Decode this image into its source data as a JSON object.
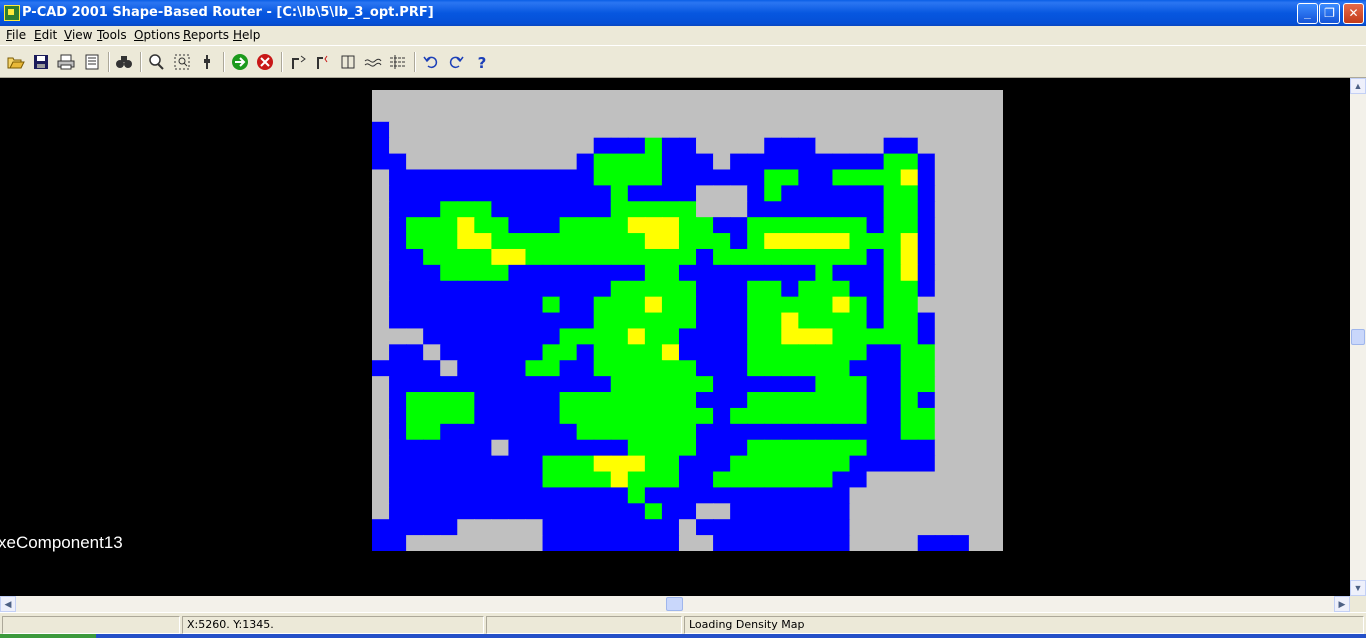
{
  "window": {
    "title": "P-CAD 2001 Shape-Based Router - [C:\\lb\\5\\lb_3_opt.PRF]",
    "buttons": {
      "minimize": "_",
      "restore": "❐",
      "close": "✕"
    }
  },
  "menu": [
    {
      "label": "File",
      "hotkey": "F",
      "rest": "ile"
    },
    {
      "label": "Edit",
      "hotkey": "E",
      "rest": "dit"
    },
    {
      "label": "View",
      "hotkey": "V",
      "rest": "iew"
    },
    {
      "label": "Tools",
      "hotkey": "T",
      "rest": "ools"
    },
    {
      "label": "Options",
      "hotkey": "O",
      "rest": "ptions"
    },
    {
      "label": "Reports",
      "hotkey": "R",
      "rest": "eports"
    },
    {
      "label": "Help",
      "hotkey": "H",
      "rest": "elp"
    }
  ],
  "toolbar": [
    {
      "name": "open-icon"
    },
    {
      "name": "save-icon"
    },
    {
      "name": "print-icon"
    },
    {
      "name": "print-setup-icon"
    },
    {
      "name": "find-icon"
    },
    {
      "name": "zoom-icon"
    },
    {
      "name": "zoom-window-icon"
    },
    {
      "name": "pin-icon"
    },
    {
      "name": "start-route-icon"
    },
    {
      "name": "stop-route-icon"
    },
    {
      "name": "route-1-icon"
    },
    {
      "name": "route-2-icon"
    },
    {
      "name": "route-3-icon"
    },
    {
      "name": "route-4-icon"
    },
    {
      "name": "route-5-icon"
    },
    {
      "name": "undo-icon"
    },
    {
      "name": "redo-icon"
    },
    {
      "name": "help-icon"
    }
  ],
  "canvas": {
    "label": "xeComponent13",
    "density_colors": {
      "G": "#c0c0c0",
      "B": "#0000ff",
      "N": "#00ff00",
      "Y": "#ffff00",
      "K": "#000000"
    },
    "density_map": [
      "GGGGGGGGGGGGGGGGGGGGGGGGGGGGGGGGGGGGG",
      "GGGGGGGGGGGGGGGGGGGGGGGGGGGGGGGGGGGGG",
      "BGGGGGGGGGGGGGGGGGGGGGGGGGGGGGGGGGGGG",
      "BGGGGGGGGGGGGBBBNBBGGGGBBBGGGGBBGGGGG",
      "BBGGGGGGGGGGBNNNNBBBGBBBBBBBBBNNBGGGG",
      "GBBBBBBBBBBBBNNNNBBBBBBNNBBNNNNYBGGGG",
      "GBBBBBBBBBBBBBNBBBBGGGBNBBBBBBNNBGGGG",
      "GBBBNNNBBBBBBBNNNNNGGGBBBBBBBBNNBGGGG",
      "GBNNNYNNBBBNNNNYYYNNBBNNNNNNNBNNBGGGG",
      "GBNNNYYNNNNNNNNNYYNNNBNYYYYYNNNYBGGGG",
      "GBBNNNNYYNNNNNNNNNNBNNNNNNNNNBNYBGGGG",
      "GBBBNNNNBBBBBBBBNNBBBBBBBBNBBBNYBGGGG",
      "GBBBBBBBBBBBBBNNNNNBBBNNBNNNBBNNBGGGG",
      "GBBBBBBBBBNBBNNNYNNBBBNNNNNYNBNNGGGGG",
      "GBBBBBBBBBBBBNNNNNNBBBNNYNNNNBNNBGGGG",
      "GGGBBBBBBBBNNNNYNNBBBBNNYYYNNNNNBGGGG",
      "GBBGBBBBBBNNBNNNNYBBBBNNNNNNNBBNNGGGG",
      "BBBBGBBBBNNBBNNNNNNBBBNNNNNNBBBNNGGGG",
      "GBBBBBBBBBBBBBNNNNNNBBBBBBNNNBBNNGGGG",
      "GBNNNNBBBBBNNNNNNNNBBBNNNNNNNBBNBGGGG",
      "GBNNNNBBBBBNNNNNNNNNBNNNNNNNNBBNNGGGG",
      "GBNNBBBBBBBBNNNNNNNBBBBBBBBBBBBNNGGGG",
      "GBBBBBBGBBBBBBBNNNNBBBNNNNNNNBBBBGGGG",
      "GBBBBBBBBBNNNYYYNNBBBNNNNNNNBBBBBGGGG",
      "GBBBBBBBBBNNNNYNNNBBNNNNNNNBBGGGGGGGG",
      "GBBBBBBBBBBBBBBNBBBBBBBBBBBBGGGGGGGGG",
      "GBBBBBBBBBBBBBBBNBBGGBBBBBBBGGGGGGGGG",
      "BBBBBGGGGGBBBBBBBBGBBBBBBBBBGGGGGGGGG",
      "BBGGGGGGGGBBBBBBBBGGBBBBBBBBGGGGBBBGG"
    ]
  },
  "scrollbars": {
    "up": "▲",
    "down": "▼",
    "left": "◀",
    "right": "▶"
  },
  "status": {
    "pane1": "",
    "coords": "X:5260. Y:1345.",
    "pane3": "",
    "message": "Loading Density Map"
  }
}
